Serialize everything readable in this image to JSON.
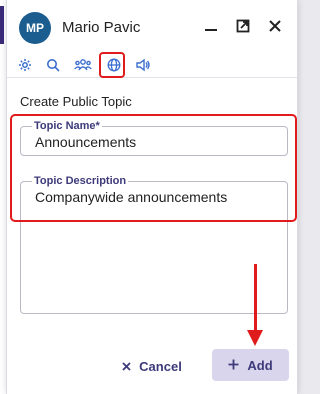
{
  "header": {
    "avatar_initials": "MP",
    "user_name": "Mario Pavic",
    "avatar_color": "#1c5d8f"
  },
  "toolbar": {
    "icons": [
      "gear-icon",
      "search-icon",
      "group-icon",
      "globe-icon",
      "speaker-icon"
    ],
    "selected": "globe-icon"
  },
  "form": {
    "title": "Create Public Topic",
    "topic_name_label": "Topic Name*",
    "topic_name_value": "Announcements",
    "topic_description_label": "Topic Description",
    "topic_description_value": "Companywide announcements"
  },
  "actions": {
    "cancel_label": "Cancel",
    "add_label": "Add"
  },
  "colors": {
    "accent": "#3d3a7a",
    "annotation_red": "#e01b1b",
    "add_button_bg": "#d9d5ec"
  }
}
